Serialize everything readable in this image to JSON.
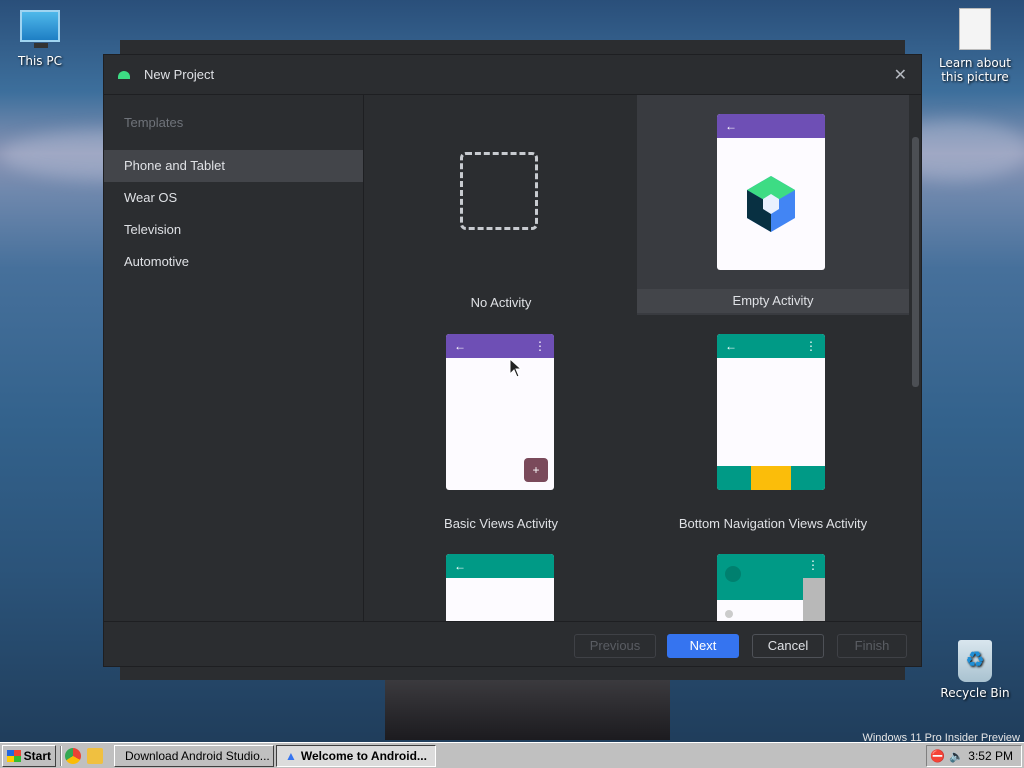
{
  "desktop": {
    "icons": [
      {
        "label": "This PC"
      },
      {
        "label": "Learn about this picture"
      },
      {
        "label": "Recycle Bin"
      }
    ],
    "watermark": "Windows 11 Pro Insider Preview"
  },
  "dialog": {
    "title": "New Project",
    "sidebar": {
      "header": "Templates",
      "items": [
        {
          "label": "Phone and Tablet",
          "selected": true
        },
        {
          "label": "Wear OS"
        },
        {
          "label": "Television"
        },
        {
          "label": "Automotive"
        }
      ]
    },
    "templates": [
      {
        "label": "No Activity"
      },
      {
        "label": "Empty Activity",
        "selected": true
      },
      {
        "label": "Basic Views Activity"
      },
      {
        "label": "Bottom Navigation Views Activity"
      }
    ],
    "buttons": {
      "previous": "Previous",
      "next": "Next",
      "cancel": "Cancel",
      "finish": "Finish"
    },
    "colors": {
      "accent": "#3574f0",
      "purple_bar": "#6e4fb5",
      "teal_bar": "#009a86",
      "nav_highlight": "#fbbd0a"
    }
  },
  "taskbar": {
    "start_label": "Start",
    "tasks": [
      {
        "label": "Download Android Studio..."
      },
      {
        "label": "Welcome to Android...",
        "active": true
      }
    ],
    "clock": "3:52 PM"
  }
}
